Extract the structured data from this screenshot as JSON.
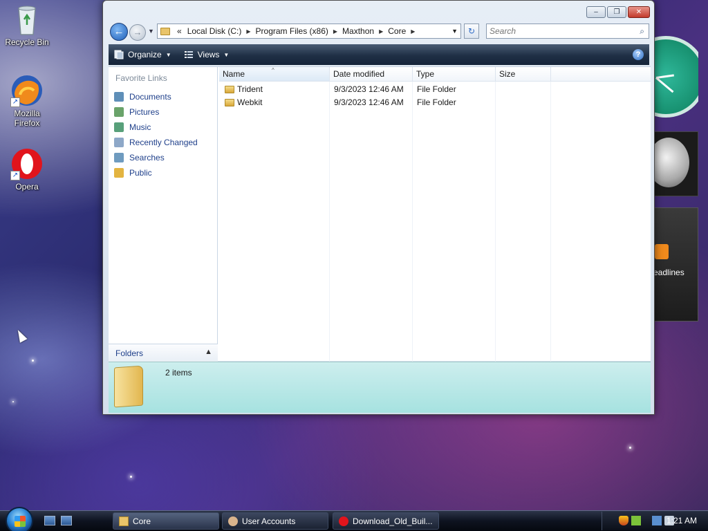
{
  "desktop": {
    "icons": [
      {
        "label": "Recycle Bin"
      },
      {
        "label": "Mozilla Firefox"
      },
      {
        "label": "Opera"
      }
    ],
    "feed_gadget_text": "eadlines"
  },
  "window": {
    "caption": {
      "minimize": "–",
      "maximize": "❐",
      "close": "✕"
    },
    "address": {
      "prefix": "«",
      "segments": [
        "Local Disk (C:)",
        "Program Files (x86)",
        "Maxthon",
        "Core"
      ]
    },
    "search": {
      "placeholder": "Search"
    },
    "toolbar": {
      "organize": "Organize",
      "views": "Views"
    },
    "nav_pane": {
      "title": "Favorite Links",
      "items": [
        {
          "label": "Documents",
          "color": "#5f8fb8"
        },
        {
          "label": "Pictures",
          "color": "#6aa36a"
        },
        {
          "label": "Music",
          "color": "#58a07a"
        },
        {
          "label": "Recently Changed",
          "color": "#8ea8c8"
        },
        {
          "label": "Searches",
          "color": "#6f9bbf"
        },
        {
          "label": "Public",
          "color": "#e3b440"
        }
      ],
      "folders_label": "Folders"
    },
    "columns": [
      "Name",
      "Date modified",
      "Type",
      "Size"
    ],
    "rows": [
      {
        "name": "Trident",
        "date": "9/3/2023 12:46 AM",
        "type": "File Folder",
        "size": ""
      },
      {
        "name": "Webkit",
        "date": "9/3/2023 12:46 AM",
        "type": "File Folder",
        "size": ""
      }
    ],
    "details": {
      "count": "2 items"
    }
  },
  "taskbar": {
    "tasks": [
      {
        "label": "Core"
      },
      {
        "label": "User Accounts"
      },
      {
        "label": "Download_Old_Buil..."
      }
    ],
    "clock": "1:21 AM"
  }
}
